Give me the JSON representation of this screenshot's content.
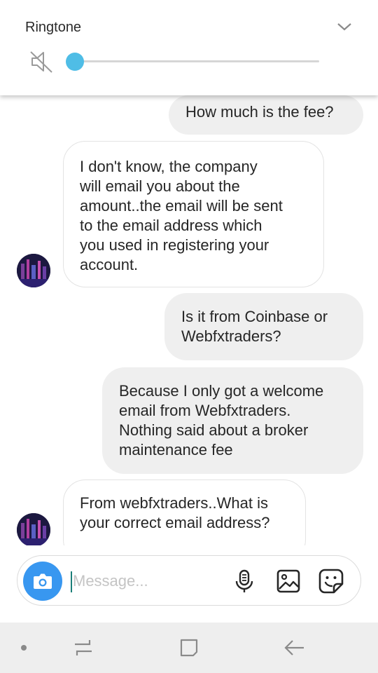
{
  "volume_panel": {
    "label": "Ringtone",
    "muted": true,
    "level": 0,
    "accent_color": "#4fbde6",
    "icons": [
      "speaker-muted-icon",
      "chevron-down-icon"
    ]
  },
  "conversation": {
    "messages": [
      {
        "direction": "outgoing",
        "lines": [
          "How much is the fee?"
        ]
      },
      {
        "direction": "incoming",
        "lines": [
          "I don't know, the company",
          "will email you about the",
          "amount..the email will be sent",
          "to the email address which",
          "you used in registering your",
          "account."
        ]
      },
      {
        "direction": "outgoing",
        "lines": [
          "Is it from Coinbase or",
          "Webfxtraders?"
        ]
      },
      {
        "direction": "outgoing",
        "lines": [
          "Because I only got a welcome",
          "email from Webfxtraders.",
          "Nothing said about a broker",
          "maintenance fee"
        ]
      },
      {
        "direction": "incoming",
        "lines": [
          "From webfxtraders..What is",
          "your correct email address?"
        ]
      }
    ],
    "outgoing_bubble_color": "#efefef",
    "incoming_bubble_color": "#ffffff"
  },
  "composer": {
    "placeholder": "Message...",
    "value": "",
    "camera_color": "#3897f0",
    "icons": [
      "camera-icon",
      "microphone-icon",
      "gallery-icon",
      "sticker-icon"
    ]
  },
  "navigation_bar": {
    "icons": [
      "dot-icon",
      "recent-apps-icon",
      "home-icon",
      "back-icon"
    ]
  }
}
